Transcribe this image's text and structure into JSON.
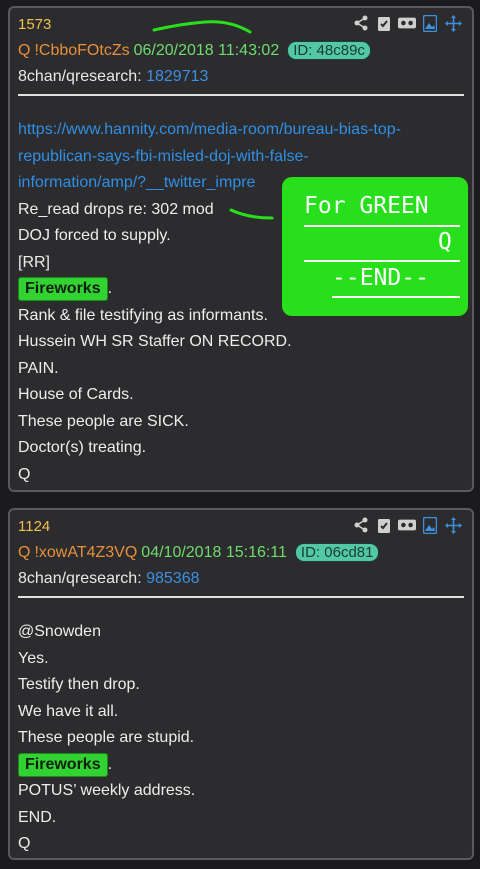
{
  "posts": [
    {
      "number": "1573",
      "q": "Q",
      "tripcode": "!CbboFOtcZs",
      "date": "06/20/2018 11:43:02",
      "id": "ID: 48c89c",
      "board": "8chan/qresearch:",
      "board_link": "1829713",
      "url_lines": [
        "https://www.hannity.com/media-room/bureau-bias-top-",
        "republican-says-fbi-misled-doj-with-false-",
        "information/amp/?__twitter_impre"
      ],
      "lines": [
        "Re_read drops re: 302 mod",
        "DOJ forced to supply.",
        "[RR]",
        "",
        "Rank & file testifying as informants.",
        "Hussein WH SR Staffer ON RECORD.",
        "PAIN.",
        "House of Cards.",
        "These people are SICK.",
        "Doctor(s) treating.",
        "Q"
      ],
      "tag": "Fireworks"
    },
    {
      "number": "1124",
      "q": "Q",
      "tripcode": "!xowAT4Z3VQ",
      "date": "04/10/2018 15:16:11",
      "id": "ID: 06cd81",
      "board": "8chan/qresearch:",
      "board_link": "985368",
      "lines": [
        "@Snowden",
        "Yes.",
        "Testify then drop.",
        "We have it all.",
        "These people are stupid.",
        "",
        "POTUS’ weekly address.",
        "END.",
        "Q"
      ],
      "tag": "Fireworks"
    }
  ],
  "overlay": {
    "line1": "For GREEN",
    "line2": "Q",
    "line3": "--END--"
  },
  "punct": ".",
  "icons": [
    "share-icon",
    "clipboard-check-icon",
    "vr-icon",
    "image-icon",
    "move-icon"
  ],
  "colors": {
    "card_bg": "#2c2c2e",
    "number": "#f0c24a",
    "tripcode": "#e8903a",
    "date": "#6fdc6f",
    "link": "#3d8fe0",
    "overlay": "#27e01b"
  }
}
